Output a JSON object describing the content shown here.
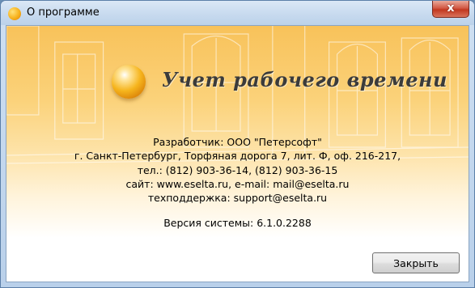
{
  "window": {
    "title": "О программе",
    "close_glyph": "x",
    "icon": "app-orange-ball-icon"
  },
  "banner": {
    "product_name": "Учет рабочего времени",
    "logo_icon": "orange-sphere-logo-icon"
  },
  "info": {
    "developer": "Разработчик: ООО \"Петерсофт\"",
    "address": "г. Санкт-Петербург, Торфяная дорога 7, лит. Ф, оф. 216-217,",
    "phone": "тел.: (812) 903-36-14, (812) 903-36-15",
    "site": "сайт: www.eselta.ru, e-mail: mail@eselta.ru",
    "support": "техподдержка: support@eselta.ru",
    "version": "Версия системы: 6.1.0.2288"
  },
  "buttons": {
    "close_label": "Закрыть"
  },
  "colors": {
    "accent_orange": "#f6b51d",
    "titlebar": "#c6d9ee",
    "close_red": "#c2371f"
  }
}
